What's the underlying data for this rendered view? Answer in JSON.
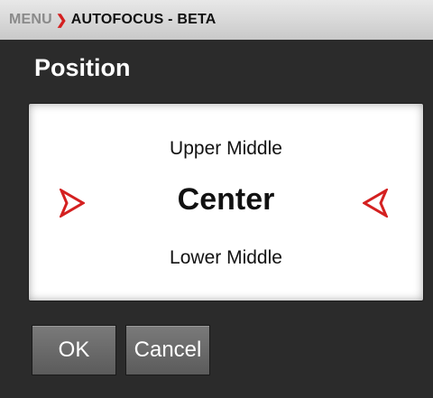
{
  "breadcrumb": {
    "menu": "MENU",
    "separator": ">",
    "page": "AUTOFOCUS - BETA"
  },
  "title": "Position",
  "picker": {
    "upper": "Upper Middle",
    "selected": "Center",
    "lower": "Lower Middle",
    "arrow_color": "#d42020"
  },
  "buttons": {
    "ok": "OK",
    "cancel": "Cancel"
  }
}
